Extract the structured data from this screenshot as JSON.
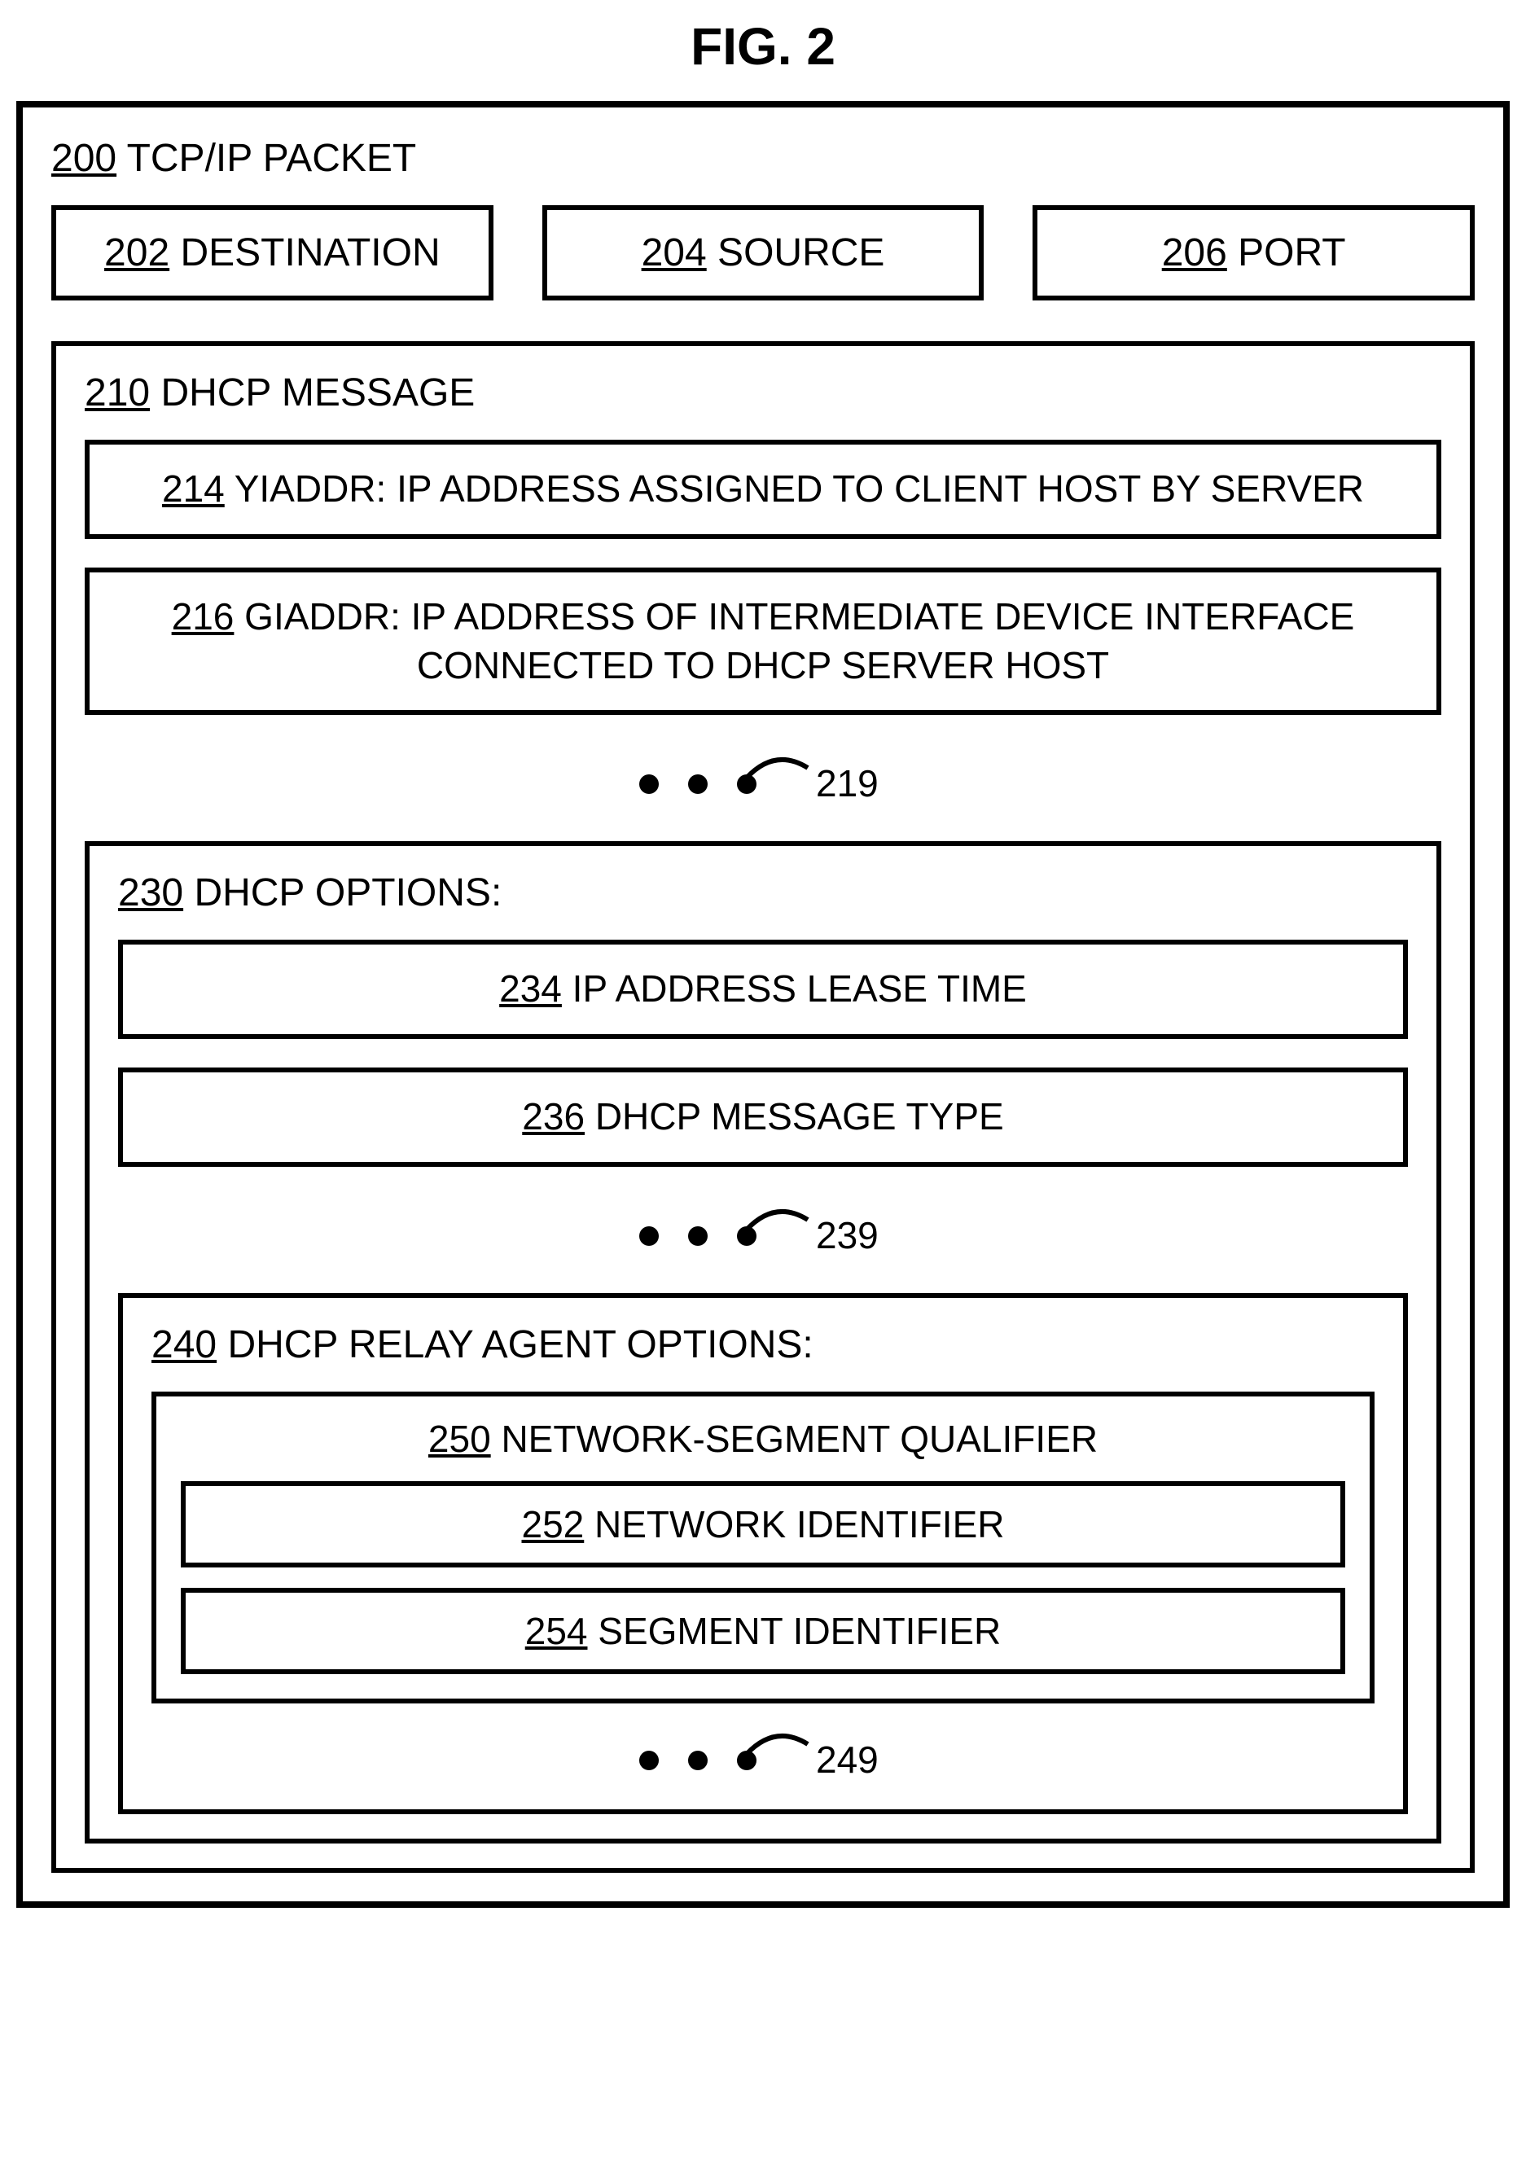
{
  "figTitle": "FIG. 2",
  "packet": {
    "num": "200",
    "label": "TCP/IP PACKET",
    "header": [
      {
        "num": "202",
        "label": "DESTINATION"
      },
      {
        "num": "204",
        "label": "SOURCE"
      },
      {
        "num": "206",
        "label": "PORT"
      }
    ],
    "dhcpMessage": {
      "num": "210",
      "label": "DHCP MESSAGE",
      "yiaddr": {
        "num": "214",
        "label": "YIADDR: IP ADDRESS ASSIGNED TO CLIENT HOST BY SERVER"
      },
      "giaddr": {
        "num": "216",
        "label": "GIADDR: IP ADDRESS OF INTERMEDIATE DEVICE INTERFACE CONNECTED TO DHCP SERVER HOST"
      },
      "ellipsis1": "219",
      "options": {
        "num": "230",
        "label": "DHCP OPTIONS:",
        "leaseTime": {
          "num": "234",
          "label": "IP ADDRESS LEASE TIME"
        },
        "msgType": {
          "num": "236",
          "label": "DHCP MESSAGE TYPE"
        },
        "ellipsis2": "239",
        "relayAgent": {
          "num": "240",
          "label": "DHCP RELAY AGENT OPTIONS:",
          "qualifier": {
            "num": "250",
            "label": "NETWORK-SEGMENT QUALIFIER",
            "network": {
              "num": "252",
              "label": "NETWORK IDENTIFIER"
            },
            "segment": {
              "num": "254",
              "label": "SEGMENT IDENTIFIER"
            }
          },
          "ellipsis3": "249"
        }
      }
    }
  }
}
